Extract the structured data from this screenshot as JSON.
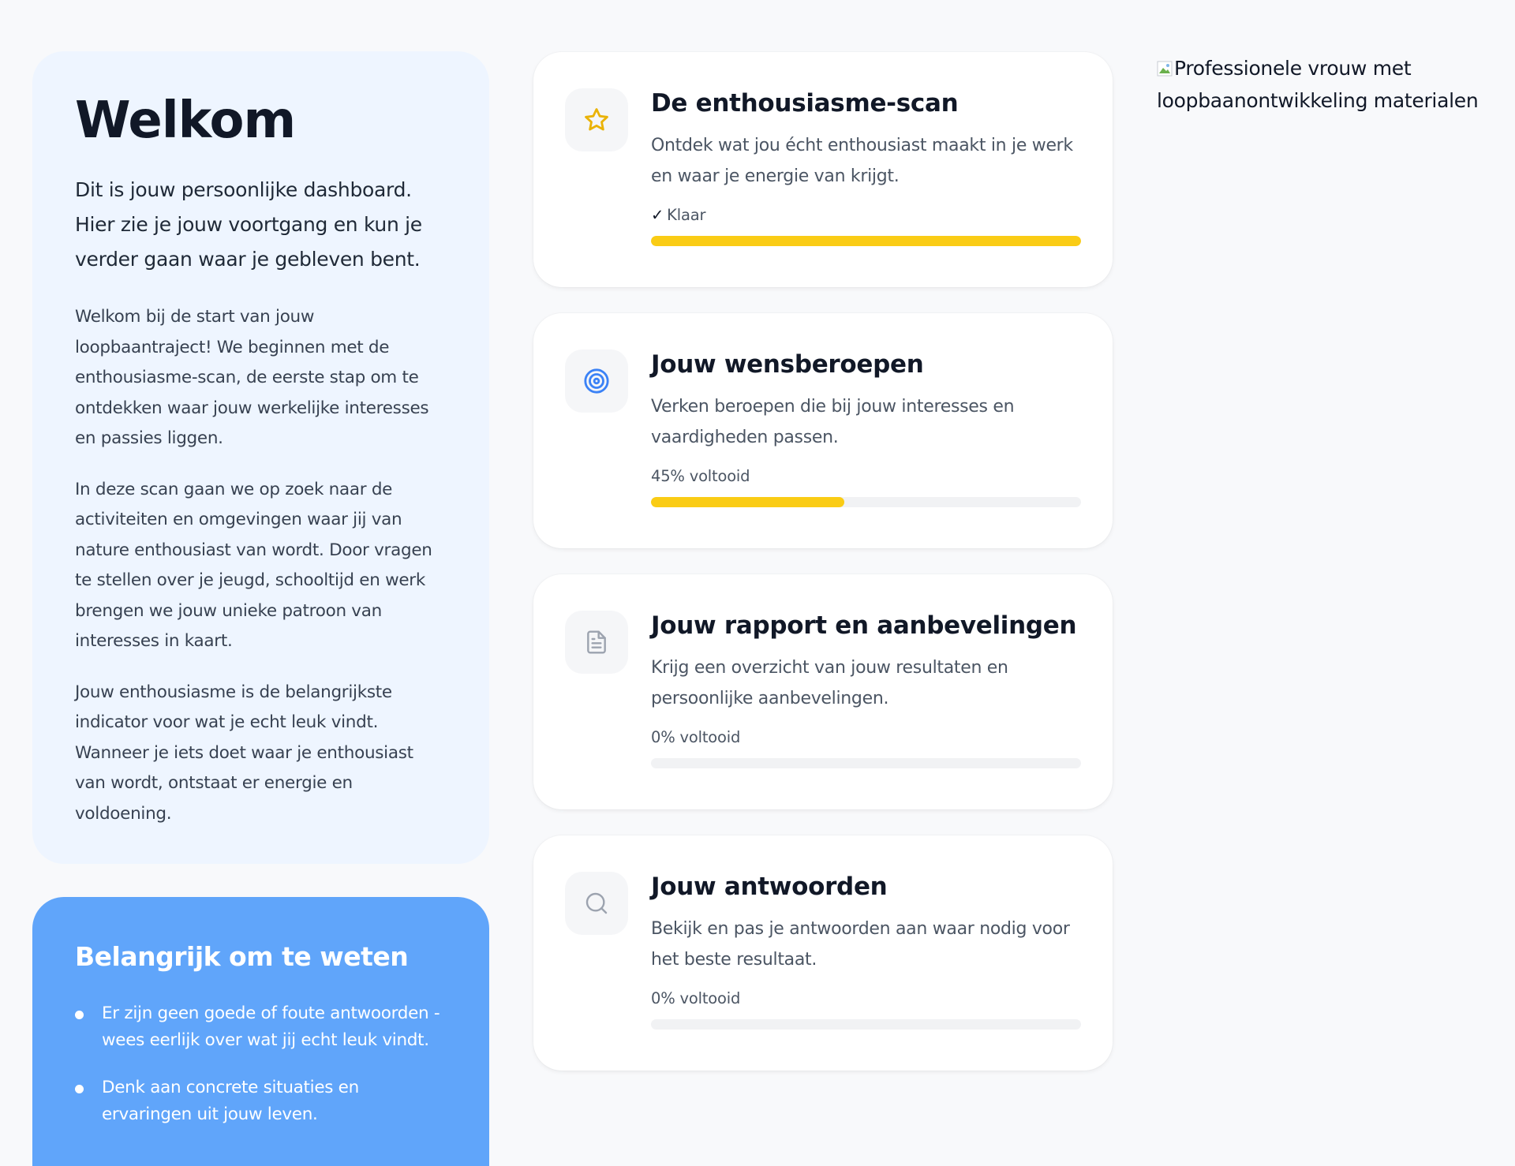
{
  "intro": {
    "title": "Welkom",
    "lead": "Dit is jouw persoonlijke dashboard. Hier zie je jouw voortgang en kun je verder gaan waar je gebleven bent.",
    "paragraphs": [
      "Welkom bij de start van jouw loopbaantraject! We beginnen met de enthousiasme-scan, de eerste stap om te ontdekken waar jouw werkelijke interesses en passies liggen.",
      "In deze scan gaan we op zoek naar de activiteiten en omgevingen waar jij van nature enthousiast van wordt. Door vragen te stellen over je jeugd, schooltijd en werk brengen we jouw unieke patroon van interesses in kaart.",
      "Jouw enthousiasme is de belangrijkste indicator voor wat je echt leuk vindt. Wanneer je iets doet waar je enthousiast van wordt, ontstaat er energie en voldoening."
    ]
  },
  "info": {
    "title": "Belangrijk om te weten",
    "items": [
      "Er zijn geen goede of foute antwoorden - wees eerlijk over wat jij echt leuk vindt.",
      "Denk aan concrete situaties en ervaringen uit jouw leven."
    ]
  },
  "steps": [
    {
      "icon": "star-icon",
      "title": "De enthousiasme-scan",
      "description": "Ontdek wat jou écht enthousiast maakt in je werk en waar je energie van krijgt.",
      "status_check": "✓",
      "status": "Klaar",
      "progress": 1.0
    },
    {
      "icon": "target-icon",
      "title": "Jouw wensberoepen",
      "description": "Verken beroepen die bij jouw interesses en vaardigheden passen.",
      "status": "45% voltooid",
      "progress": 0.45
    },
    {
      "icon": "document-icon",
      "title": "Jouw rapport en aanbevelingen",
      "description": "Krijg een overzicht van jouw resultaten en persoonlijke aanbevelingen.",
      "status": "0% voltooid",
      "progress": 0
    },
    {
      "icon": "search-icon",
      "title": "Jouw antwoorden",
      "description": "Bekijk en pas je antwoorden aan waar nodig voor het beste resultaat.",
      "status": "0% voltooid",
      "progress": 0
    }
  ],
  "hero_image": {
    "alt": "Professionele vrouw met loopbaanontwikkeling materialen"
  },
  "colors": {
    "accent_yellow": "#facc15",
    "info_blue": "#60a5fa",
    "intro_bg": "#eef5ff",
    "target_blue": "#3b82f6"
  }
}
